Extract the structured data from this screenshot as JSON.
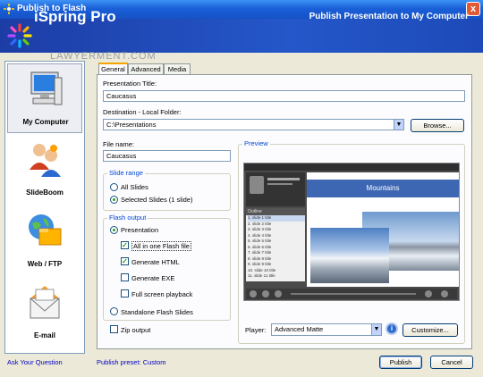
{
  "window": {
    "title": "Publish to Flash",
    "close_label": "x"
  },
  "header": {
    "brand": "iSpring Pro",
    "subtitle": "Publish Presentation to My Computer"
  },
  "watermark": "LAWYERMENT.COM",
  "nav": [
    {
      "label": "My Computer",
      "icon": "computer-icon"
    },
    {
      "label": "SlideBoom",
      "icon": "people-icon"
    },
    {
      "label": "Web / FTP",
      "icon": "globe-folder-icon"
    },
    {
      "label": "E-mail",
      "icon": "envelope-icon"
    }
  ],
  "tabs": [
    "General",
    "Advanced",
    "Media"
  ],
  "form": {
    "title_label": "Presentation Title:",
    "title_value": "Caucasus",
    "dest_label": "Destination - Local Folder:",
    "dest_value": "C:\\Presentations",
    "browse_label": "Browse...",
    "filename_label": "File name:",
    "filename_value": "Caucasus"
  },
  "slide_range": {
    "title": "Slide range",
    "all": "All Slides",
    "selected": "Selected Slides (1 slide)"
  },
  "flash_output": {
    "title": "Flash output",
    "presentation": "Presentation",
    "all_in_one": "All in one Flash file",
    "gen_html": "Generate HTML",
    "gen_exe": "Generate EXE",
    "fullscreen": "Full screen playback",
    "standalone": "Standalone Flash Slides"
  },
  "zip_label": "Zip output",
  "preview": {
    "title": "Preview",
    "slide_title": "Mountains",
    "outline_label": "Outline",
    "outline_items": [
      "1. slide 1 title",
      "2. slide 2 title",
      "3. slide 3 title",
      "4. slide 4 title",
      "5. slide 5 title",
      "6. slide 6 title",
      "7. slide 7 title",
      "8. slide 8 title",
      "9. slide 9 title",
      "10. slide 10 title",
      "11. slide 11 title"
    ]
  },
  "player": {
    "label": "Player:",
    "value": "Advanced Matte",
    "customize_label": "Customize..."
  },
  "footer": {
    "ask": "Ask Your Question",
    "preset": "Publish preset: Custom",
    "publish": "Publish",
    "cancel": "Cancel"
  },
  "colors": {
    "accent": "#1d3da6",
    "link": "#0000c0",
    "group_title": "#0046d5"
  }
}
